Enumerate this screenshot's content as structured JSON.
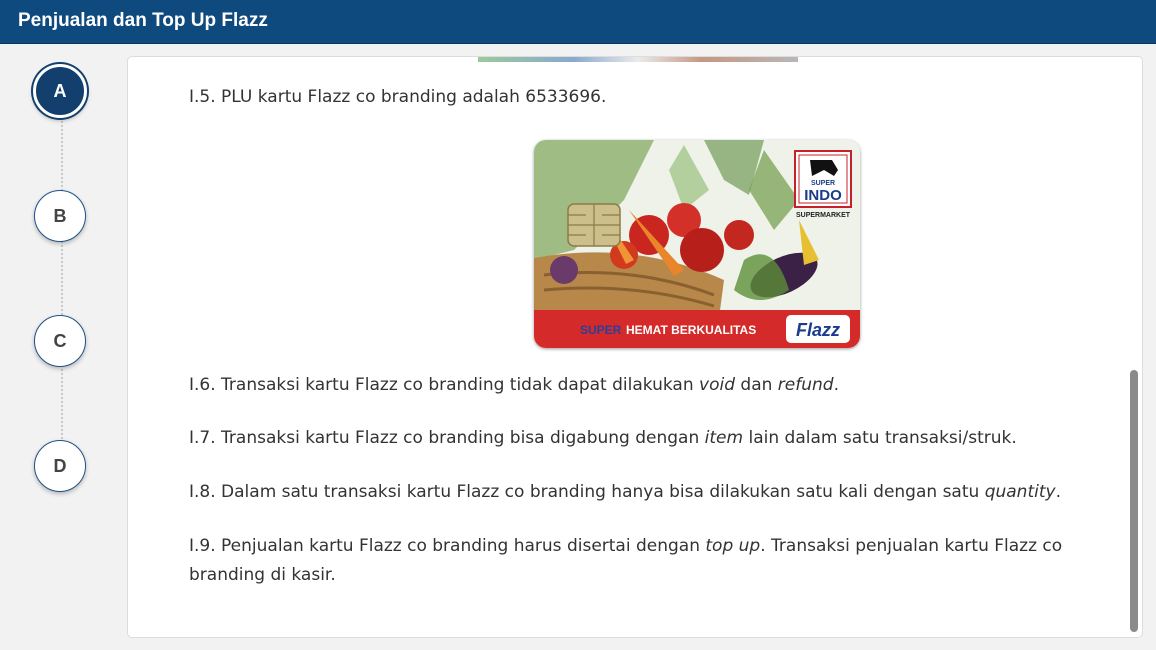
{
  "header": {
    "title": "Penjualan dan Top Up Flazz"
  },
  "steps": [
    "A",
    "B",
    "C",
    "D"
  ],
  "items": {
    "i5": "I.5.  PLU kartu Flazz co branding adalah 6533696.",
    "i6": {
      "prefix": "I.6.  Transaksi kartu Flazz co branding tidak dapat dilakukan ",
      "em1": "void",
      "mid": " dan ",
      "em2": "refund",
      "suffix": "."
    },
    "i7": {
      "prefix": "I.7.  Transaksi kartu Flazz co branding bisa digabung dengan ",
      "em": "item",
      "suffix": " lain dalam satu transaksi/struk."
    },
    "i8": {
      "prefix": "I.8.  Dalam satu transaksi kartu Flazz co branding hanya bisa dilakukan satu kali dengan satu ",
      "em": "quantity",
      "suffix": "."
    },
    "i9": {
      "prefix": "I.9.  Penjualan kartu Flazz co branding harus disertai dengan ",
      "em": "top up",
      "suffix": ". Transaksi penjualan kartu Flazz co branding di kasir."
    }
  },
  "card": {
    "logo_line1": "SUPER",
    "logo_line2": "INDO",
    "logo_sub": "SUPERMARKET",
    "band_super": "SUPER",
    "band_text": "HEMAT BERKUALITAS",
    "flazz": "Flazz"
  },
  "colors": {
    "header": "#0f4a7e",
    "step_active": "#123f6e",
    "card_band": "#d42a2a"
  }
}
